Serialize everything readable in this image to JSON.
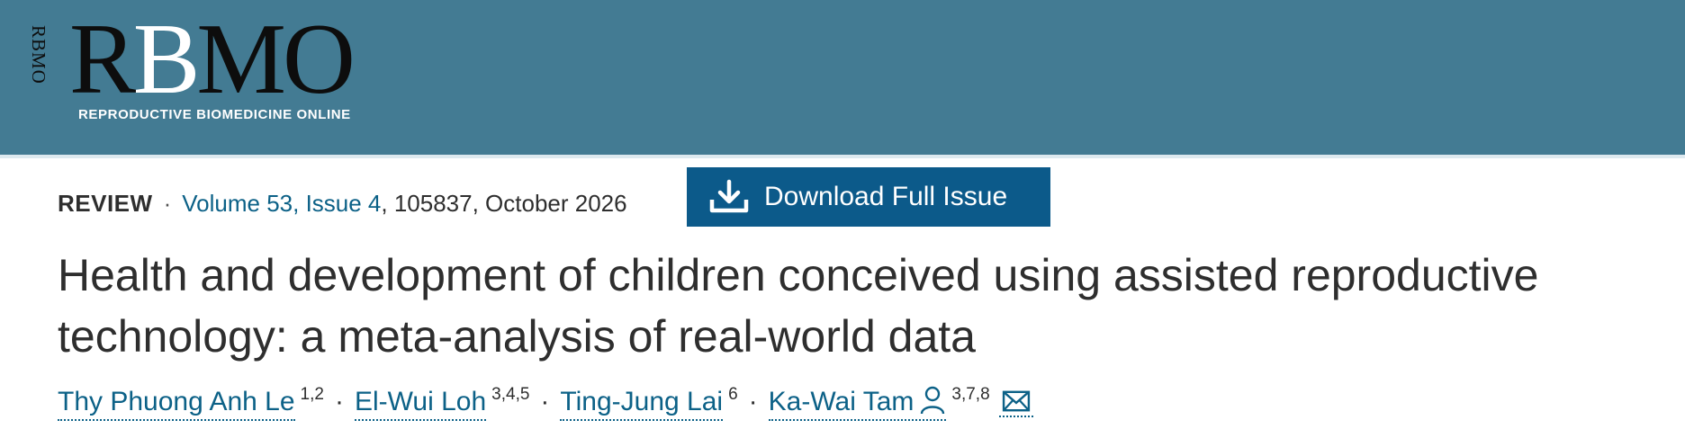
{
  "header": {
    "vertical_logo": "RBMO",
    "wordmark_parts": [
      "R",
      "B",
      "MO"
    ],
    "tagline": "REPRODUCTIVE BIOMEDICINE ONLINE"
  },
  "article_meta": {
    "type": "REVIEW",
    "separator": "·",
    "volume_issue": "Volume 53, Issue 4",
    "rest": ", 105837, October 2026"
  },
  "download_button": {
    "label": "Download Full Issue",
    "icon": "download-icon"
  },
  "title": "Health and development of children conceived using assisted reproductive technology: a meta-analysis of real-world data",
  "authors": [
    {
      "name": "Thy Phuong Anh Le",
      "affiliations": "1,2"
    },
    {
      "name": "El-Wui Loh",
      "affiliations": "3,4,5"
    },
    {
      "name": "Ting-Jung Lai",
      "affiliations": "6"
    },
    {
      "name": "Ka-Wai Tam",
      "affiliations": "3,7,8",
      "corresponding": true
    }
  ],
  "author_separator": "·",
  "colors": {
    "banner": "#437b93",
    "link": "#0c6187",
    "button": "#0c5a8a"
  }
}
